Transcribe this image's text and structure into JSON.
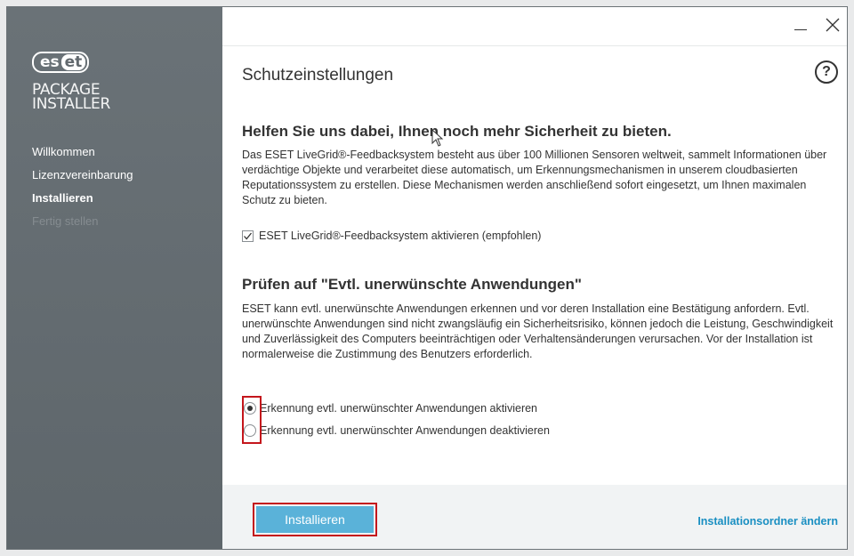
{
  "brand": {
    "logo_part1": "es",
    "logo_part2": "et",
    "product_line1": "PACKAGE",
    "product_line2": "INSTALLER"
  },
  "sidebar": {
    "items": [
      {
        "label": "Willkommen",
        "state": "done"
      },
      {
        "label": "Lizenzvereinbarung",
        "state": "done"
      },
      {
        "label": "Installieren",
        "state": "active"
      },
      {
        "label": "Fertig stellen",
        "state": "disabled"
      }
    ]
  },
  "window_controls": {
    "minimize_icon": "minimize-icon",
    "close_icon": "close-icon"
  },
  "header": {
    "title": "Schutzeinstellungen",
    "help_icon": "help-icon",
    "help_glyph": "?"
  },
  "livegrid": {
    "heading": "Helfen Sie uns dabei, Ihnen noch mehr Sicherheit zu bieten.",
    "text": "Das ESET LiveGrid®-Feedbacksystem besteht aus über 100 Millionen Sensoren weltweit, sammelt Informationen über verdächtige Objekte und verarbeitet diese automatisch, um Erkennungsmechanismen in unserem cloudbasierten Reputationssystem zu erstellen. Diese Mechanismen werden anschließend sofort eingesetzt, um Ihnen maximalen Schutz zu bieten.",
    "checkbox_label": "ESET LiveGrid®-Feedbacksystem aktivieren (empfohlen)",
    "checkbox_checked": true
  },
  "pua": {
    "heading": "Prüfen auf \"Evtl. unerwünschte Anwendungen\"",
    "text": "ESET kann evtl. unerwünschte Anwendungen erkennen und vor deren Installation eine Bestätigung anfordern. Evtl. unerwünschte Anwendungen sind nicht zwangsläufig ein Sicherheitsrisiko, können jedoch die Leistung, Geschwindigkeit und Zuverlässigkeit des Computers beeinträchtigen oder Verhaltensänderungen verursachen. Vor der Installation ist normalerweise die Zustimmung des Benutzers erforderlich.",
    "options": [
      {
        "label": "Erkennung evtl. unerwünschter Anwendungen aktivieren",
        "selected": true
      },
      {
        "label": "Erkennung evtl. unerwünschter Anwendungen deaktivieren",
        "selected": false
      }
    ]
  },
  "footer": {
    "install_label": "Installieren",
    "change_folder_label": "Installationsordner ändern"
  },
  "colors": {
    "sidebar": "#646c71",
    "accent": "#5ab2d9",
    "link": "#1a8fc2",
    "highlight": "#c4161c"
  }
}
